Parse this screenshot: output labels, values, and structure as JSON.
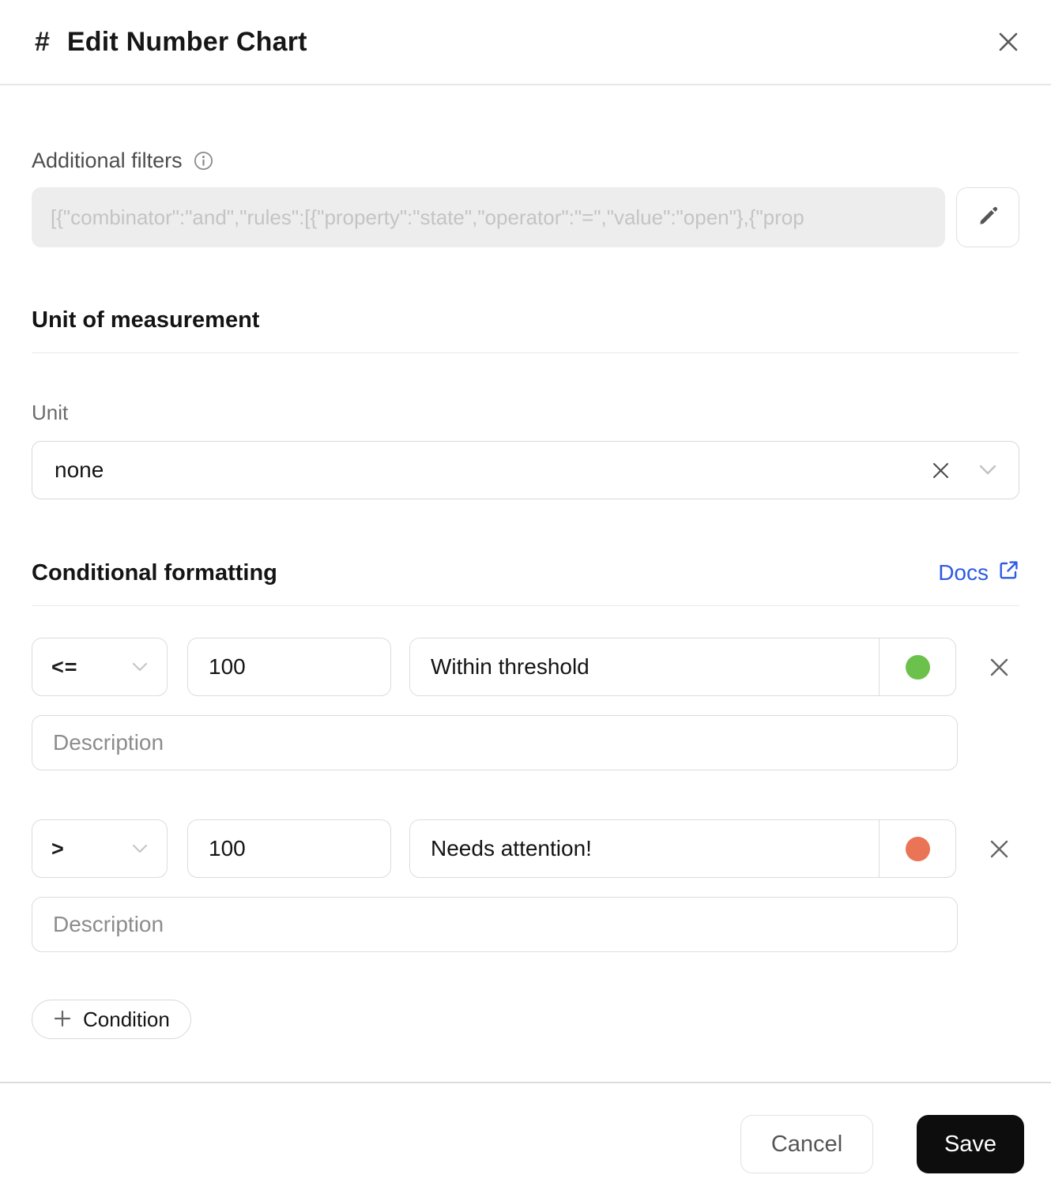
{
  "header": {
    "hash": "#",
    "title": "Edit Number Chart"
  },
  "filters": {
    "label": "Additional filters",
    "value": "[{\"combinator\":\"and\",\"rules\":[{\"property\":\"state\",\"operator\":\"=\",\"value\":\"open\"},{\"prop"
  },
  "unit_section": {
    "title": "Unit of measurement",
    "unit_label": "Unit",
    "unit_value": "none"
  },
  "conditional": {
    "title": "Conditional formatting",
    "docs_label": "Docs",
    "conditions": [
      {
        "operator": "<=",
        "value": "100",
        "label": "Within threshold",
        "color": "#6cc04c",
        "description_placeholder": "Description"
      },
      {
        "operator": ">",
        "value": "100",
        "label": "Needs attention!",
        "color": "#e97456",
        "description_placeholder": "Description"
      }
    ],
    "add_button_label": "Condition"
  },
  "footer": {
    "cancel_label": "Cancel",
    "save_label": "Save"
  },
  "colors": {
    "link_blue": "#2d5be3",
    "ok_green": "#6cc04c",
    "warn_orange": "#e97456"
  }
}
